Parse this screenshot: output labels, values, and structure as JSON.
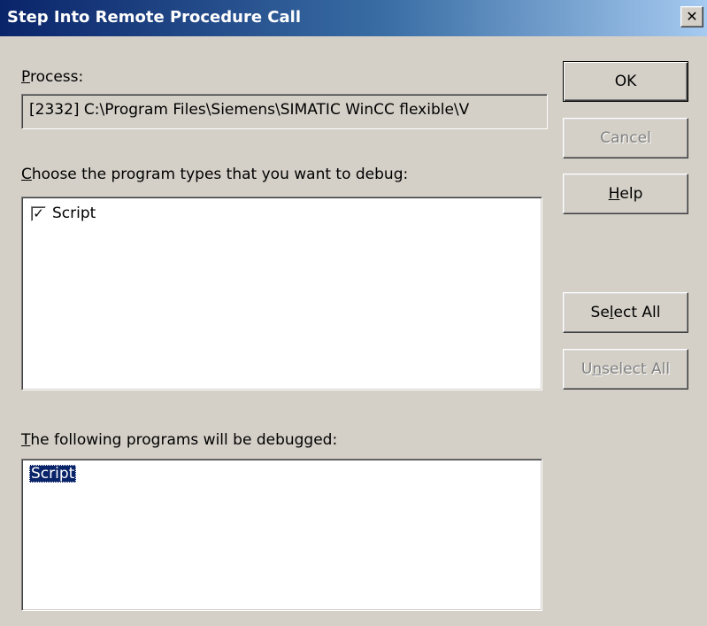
{
  "window": {
    "title": "Step Into Remote Procedure Call",
    "close_glyph": "✕"
  },
  "process": {
    "label_key": "P",
    "label_rest": "rocess:",
    "value": "[2332] C:\\Program Files\\Siemens\\SIMATIC WinCC flexible\\V"
  },
  "program_types": {
    "label_key": "C",
    "label_rest": "hoose the program types that you want to debug:",
    "items": [
      {
        "label": "Script",
        "checked": true,
        "check_glyph": "✓"
      }
    ]
  },
  "debugged": {
    "label_key": "T",
    "label_rest": "he following programs will be debugged:",
    "items": [
      {
        "label": "Script",
        "selected": true
      }
    ]
  },
  "buttons": {
    "ok": {
      "label": "OK",
      "enabled": true,
      "default": true
    },
    "cancel": {
      "label": "Cancel",
      "enabled": false
    },
    "help": {
      "pre": "",
      "key": "H",
      "post": "elp",
      "enabled": true
    },
    "select_all": {
      "pre": "Se",
      "key": "l",
      "post": "ect All",
      "enabled": true
    },
    "unselect_all": {
      "pre": "U",
      "key": "n",
      "post": "select All",
      "enabled": false
    }
  },
  "colors": {
    "title_start": "#0a246a",
    "title_end": "#a6caf0",
    "face": "#d4d0c8",
    "selection": "#0a246a"
  }
}
